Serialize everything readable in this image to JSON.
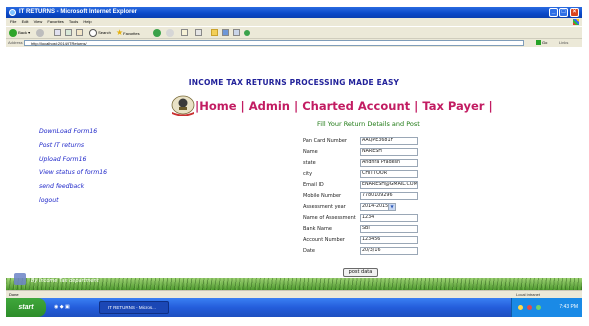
{
  "browser": {
    "window_title": "IT RETURNS - Microsoft Internet Explorer",
    "menu": [
      "File",
      "Edit",
      "View",
      "Favorites",
      "Tools",
      "Help"
    ],
    "toolbar": {
      "back": "Back",
      "search": "Search",
      "favorites": "Favorites"
    },
    "address_label": "Address",
    "address": "http://localhost:2014/ITReturns/",
    "go": "Go",
    "links": "Links"
  },
  "page": {
    "heading": "INCOME TAX RETURNS PROCESSING MADE EASY",
    "nav": [
      "Home",
      "Admin",
      "Charted Account",
      "Tax Payer"
    ],
    "separator": "|",
    "subtitle": "Fill Your Return Details and Post",
    "sidebar": [
      "DownLoad Form16",
      "Post IT returns",
      "Upload Form16",
      "View status of form16",
      "send feedback",
      "logout"
    ],
    "fields": [
      {
        "label": "Pan Card Number",
        "value": "AAQPE3681F"
      },
      {
        "label": "Name",
        "value": "NARESH"
      },
      {
        "label": "state",
        "value": "Andhra Pradesh"
      },
      {
        "label": "city",
        "value": "CHITTOOR"
      },
      {
        "label": "Email ID",
        "value": "ENARESH@GMAIL.COM"
      },
      {
        "label": "Mobile Number",
        "value": "7780109296"
      },
      {
        "label": "Assessment year",
        "value": "2014-2015",
        "type": "select"
      },
      {
        "label": "Name of Assessment",
        "value": "1234"
      },
      {
        "label": "Bank Name",
        "value": "SBI"
      },
      {
        "label": "Account Number",
        "value": "123456"
      },
      {
        "label": "Date",
        "value": "20/3/16"
      }
    ],
    "submit": "post data",
    "footer": "By Income Tax department"
  },
  "status": {
    "done": "Done",
    "zone": "Local intranet"
  },
  "taskbar": {
    "start": "start",
    "task": "IT RETURNS - Micros...",
    "clock": "7:43 PM"
  }
}
